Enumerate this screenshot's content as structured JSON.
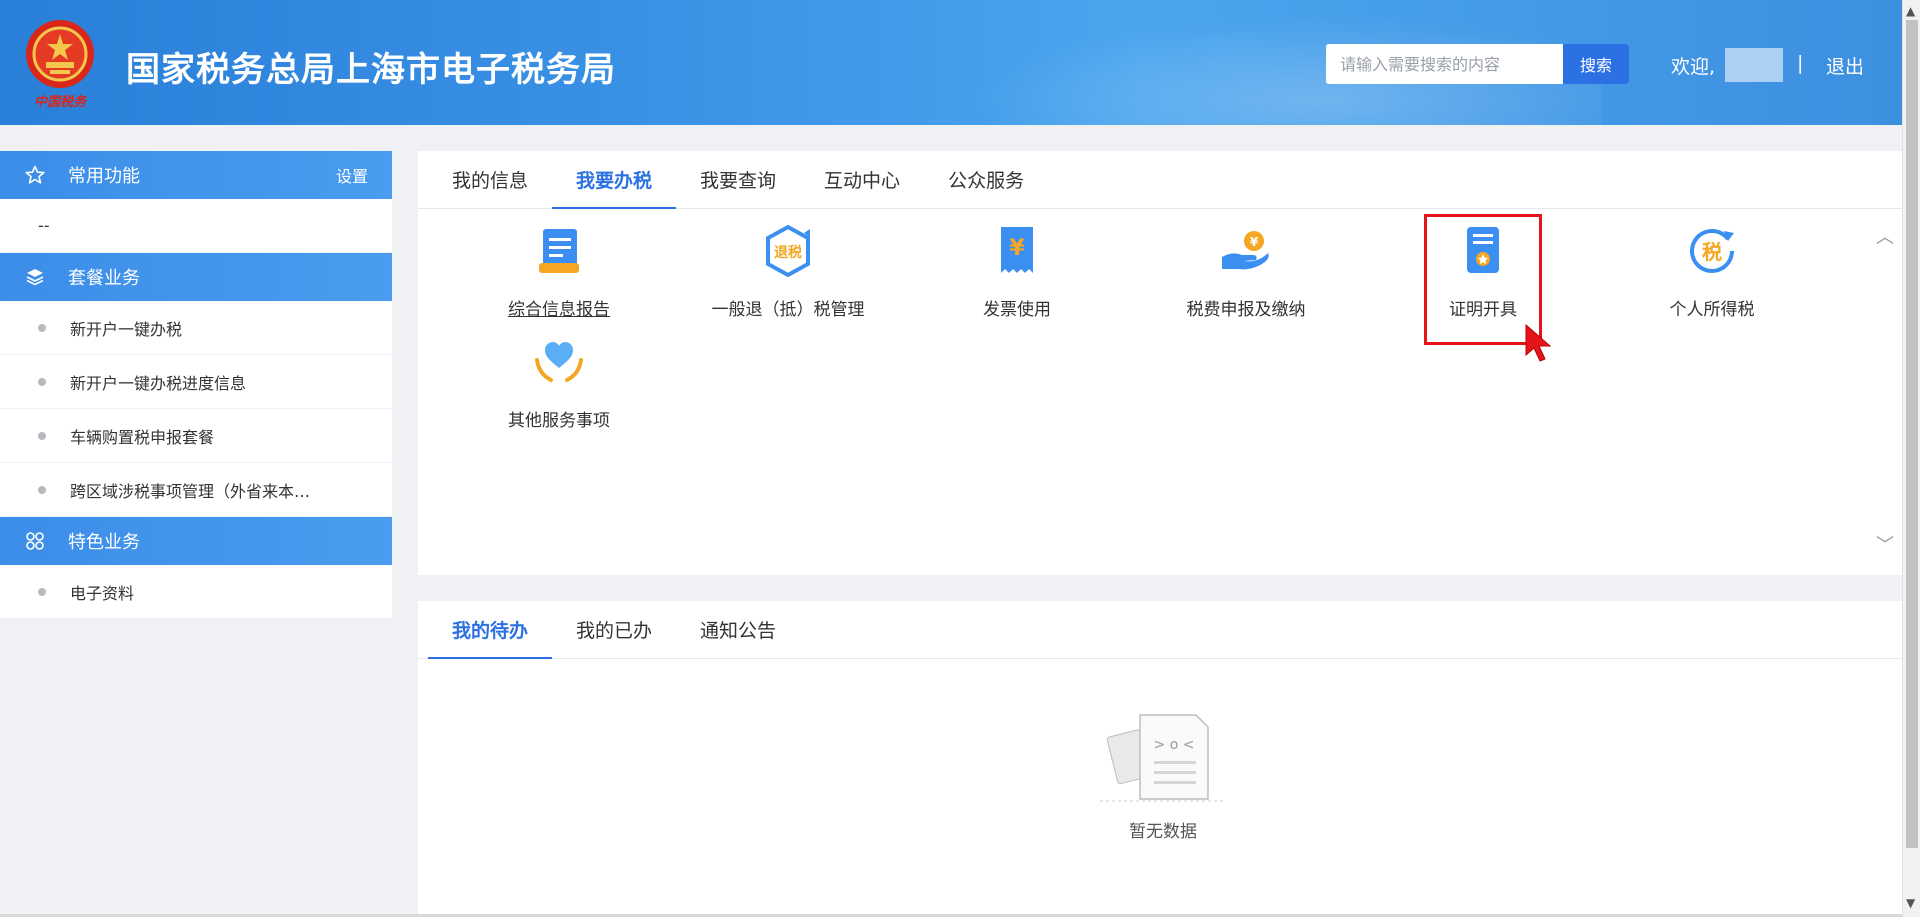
{
  "header": {
    "title": "国家税务总局上海市电子税务局",
    "emblem_caption": "中国税务",
    "search_placeholder": "请输入需要搜索的内容",
    "search_button": "搜索",
    "welcome": "欢迎,",
    "divider": "|",
    "logout": "退出"
  },
  "sidebar": {
    "sections": [
      {
        "label": "常用功能",
        "icon": "star-icon",
        "action": "设置"
      },
      {
        "label": "套餐业务",
        "icon": "layers-icon"
      },
      {
        "label": "特色业务",
        "icon": "grid-icon"
      }
    ],
    "common_placeholder": "--",
    "package_items": [
      "新开户一键办税",
      "新开户一键办税进度信息",
      "车辆购置税申报套餐",
      "跨区域涉税事项管理（外省来本…"
    ],
    "feature_items": [
      "电子资料"
    ]
  },
  "top_panel": {
    "tabs": [
      "我的信息",
      "我要办税",
      "我要查询",
      "互动中心",
      "公众服务"
    ],
    "active_tab": "我要办税",
    "items": [
      {
        "label": "综合信息报告",
        "icon": "document-icon"
      },
      {
        "label": "一般退（抵）税管理",
        "icon": "refund-tax-icon",
        "icon_text": "退税"
      },
      {
        "label": "发票使用",
        "icon": "invoice-yen-icon",
        "icon_text": "¥"
      },
      {
        "label": "税费申报及缴纳",
        "icon": "hand-coin-icon",
        "icon_text": "¥"
      },
      {
        "label": "证明开具",
        "icon": "certificate-icon"
      },
      {
        "label": "个人所得税",
        "icon": "personal-tax-icon",
        "icon_text": "税"
      },
      {
        "label": "其他服务事项",
        "icon": "heart-hands-icon"
      }
    ]
  },
  "bottom_panel": {
    "tabs": [
      "我的待办",
      "我的已办",
      "通知公告"
    ],
    "active_tab": "我的待办",
    "empty_text": "暂无数据"
  },
  "colors": {
    "primary": "#2b71e4",
    "header": "#3a92e6",
    "highlight": "#e5141a",
    "icon_blue": "#3a8ff0",
    "icon_orange": "#f5a623"
  }
}
